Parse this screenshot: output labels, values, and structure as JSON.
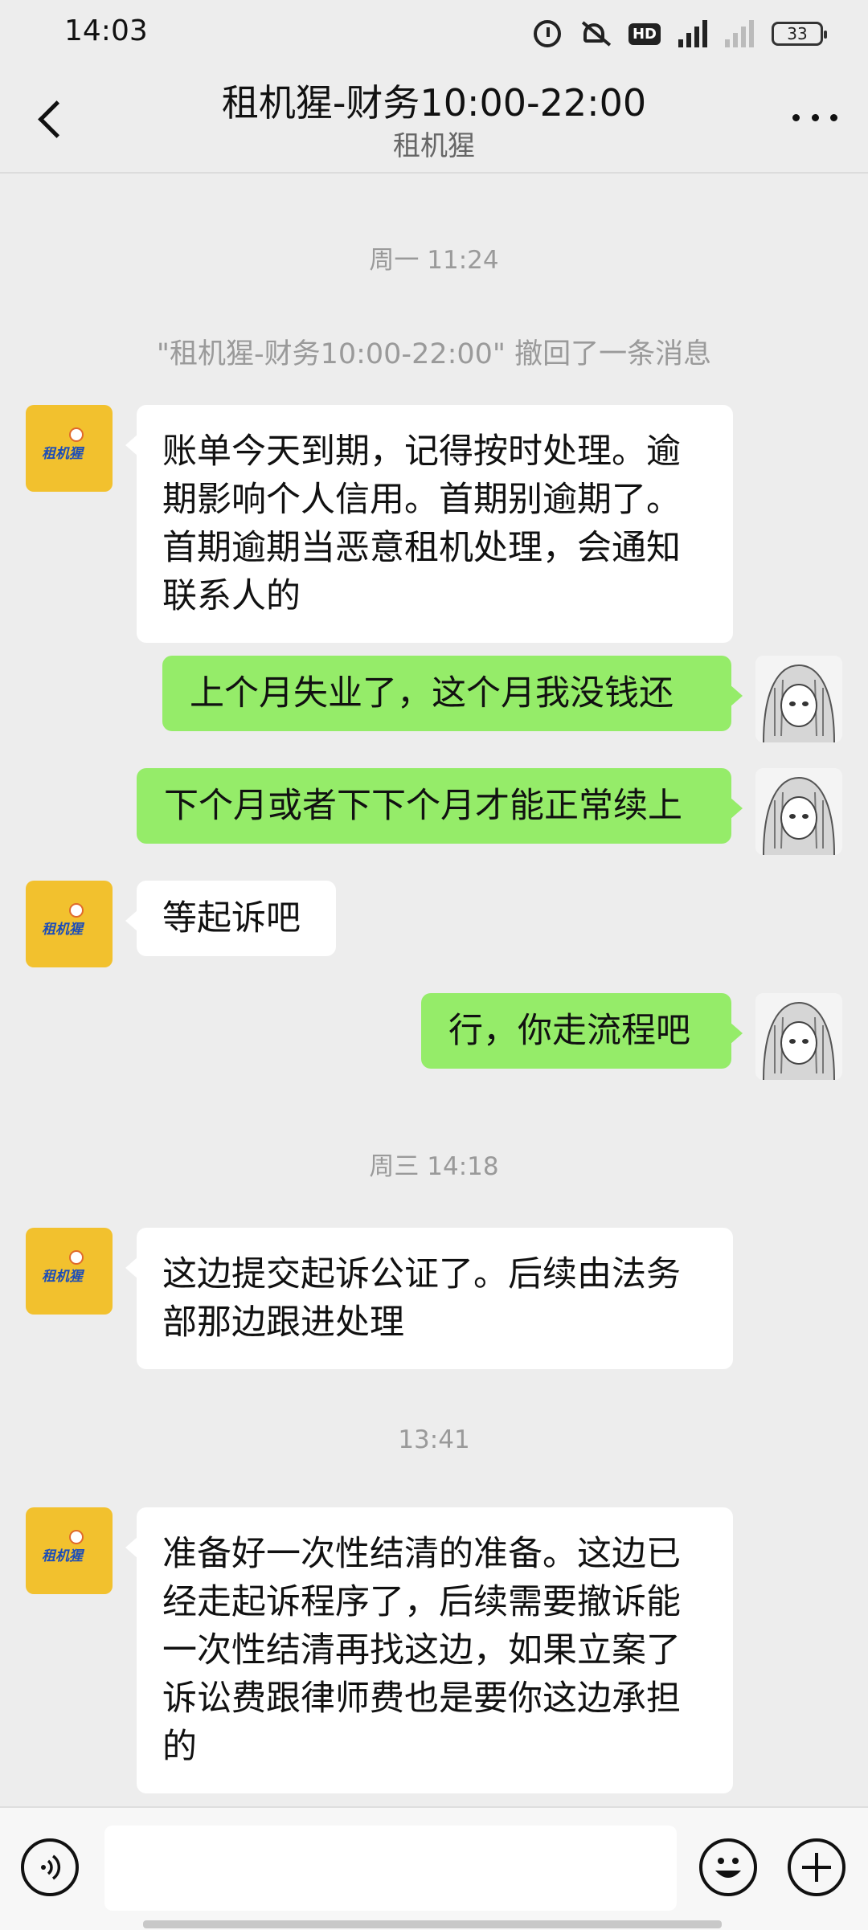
{
  "status": {
    "time": "14:03",
    "hd": "HD",
    "battery": "33"
  },
  "header": {
    "title": "租机猩-财务10:00-22:00",
    "subtitle": "租机猩"
  },
  "chat": {
    "time1": "周一 11:24",
    "system_msg": "\"租机猩-财务10:00-22:00\" 撤回了一条消息",
    "msg1": "账单今天到期，记得按时处理。逾期影响个人信用。首期别逾期了。首期逾期当恶意租机处理，会通知联系人的",
    "msg2": "上个月失业了，这个月我没钱还",
    "msg3": "下个月或者下下个月才能正常续上",
    "msg4": "等起诉吧",
    "msg5": "行，你走流程吧",
    "time2": "周三 14:18",
    "msg6": "这边提交起诉公证了。后续由法务部那边跟进处理",
    "time3": "13:41",
    "msg7": "准备好一次性结清的准备。这边已经走起诉程序了，后续需要撤诉能一次性结清再找这边，如果立案了诉讼费跟律师费也是要你这边承担的"
  },
  "avatar": {
    "bot_logo_text": "租机猩"
  },
  "input": {
    "value": ""
  },
  "icons": {
    "back": "back-arrow-icon",
    "more": "more-dots-icon",
    "voice": "voice-icon",
    "emoji": "emoji-icon",
    "plus": "plus-icon",
    "alarm": "alarm-icon",
    "mute": "mute-icon",
    "signal": "signal-icon",
    "battery": "battery-icon"
  },
  "colors": {
    "bubble_self": "#95ec69",
    "bubble_other": "#ffffff",
    "background": "#ededed",
    "bot_avatar": "#f2c12e"
  }
}
